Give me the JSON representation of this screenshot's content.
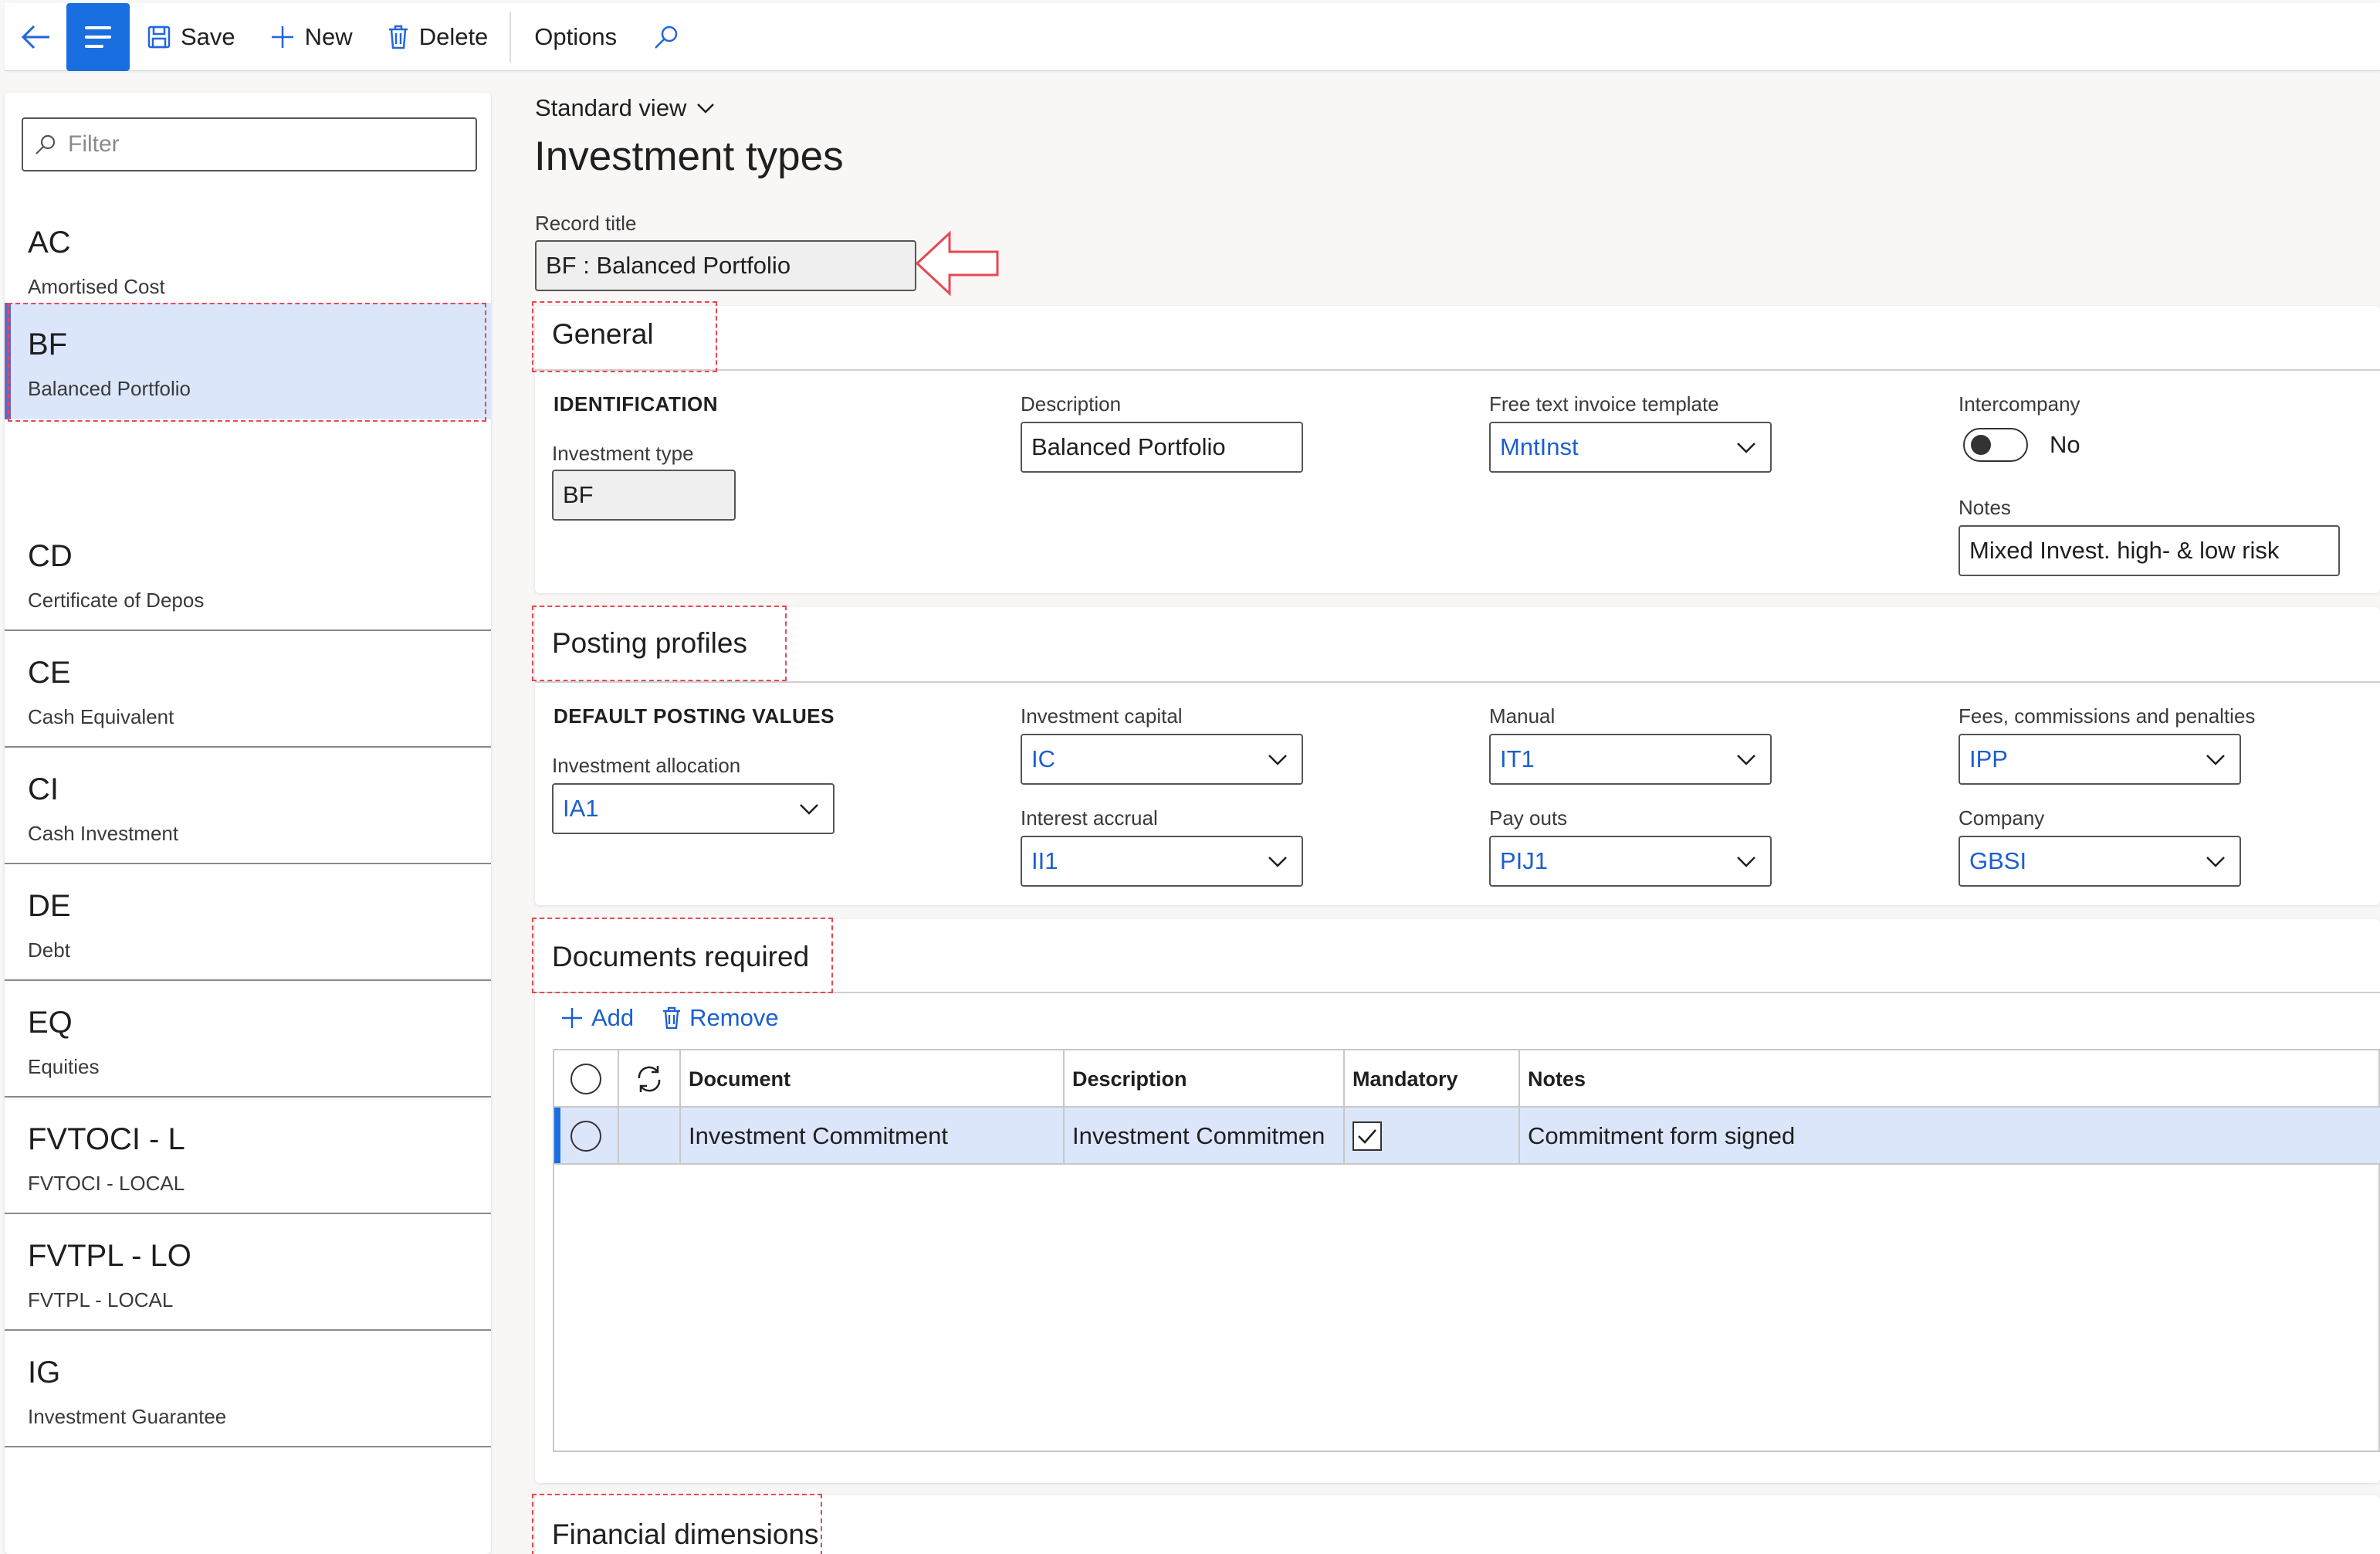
{
  "toolbar": {
    "save_label": "Save",
    "new_label": "New",
    "delete_label": "Delete",
    "options_label": "Options"
  },
  "filter": {
    "placeholder": "Filter"
  },
  "list": {
    "items": [
      {
        "code": "AC",
        "desc": "Amortised Cost"
      },
      {
        "code": "BF",
        "desc": "Balanced Portfolio"
      },
      {
        "code": "CD",
        "desc": "Certificate of Depos"
      },
      {
        "code": "CE",
        "desc": "Cash Equivalent"
      },
      {
        "code": "CI",
        "desc": "Cash Investment"
      },
      {
        "code": "DE",
        "desc": "Debt"
      },
      {
        "code": "EQ",
        "desc": "Equities"
      },
      {
        "code": "FVTOCI - L",
        "desc": "FVTOCI - LOCAL"
      },
      {
        "code": "FVTPL - LO",
        "desc": "FVTPL - LOCAL"
      },
      {
        "code": "IG",
        "desc": "Investment Guarantee"
      }
    ],
    "selected_index": 1
  },
  "page": {
    "view": "Standard view",
    "title": "Investment types",
    "record_title_label": "Record title",
    "record_title_value": "BF : Balanced Portfolio"
  },
  "general": {
    "heading": "General",
    "identification": "IDENTIFICATION",
    "investment_type_label": "Investment type",
    "investment_type_value": "BF",
    "description_label": "Description",
    "description_value": "Balanced Portfolio",
    "free_text_label": "Free text invoice template",
    "free_text_value": "MntInst",
    "intercompany_label": "Intercompany",
    "intercompany_value": "No",
    "notes_label": "Notes",
    "notes_value": "Mixed Invest. high- & low risk"
  },
  "posting": {
    "heading": "Posting profiles",
    "default_values": "DEFAULT POSTING VALUES",
    "investment_allocation_label": "Investment allocation",
    "investment_allocation_value": "IA1",
    "investment_capital_label": "Investment capital",
    "investment_capital_value": "IC",
    "interest_accrual_label": "Interest accrual",
    "interest_accrual_value": "II1",
    "manual_label": "Manual",
    "manual_value": "IT1",
    "payouts_label": "Pay outs",
    "payouts_value": "PIJ1",
    "fees_label": "Fees, commissions and penalties",
    "fees_value": "IPP",
    "company_label": "Company",
    "company_value": "GBSI"
  },
  "documents": {
    "heading": "Documents required",
    "add_label": "Add",
    "remove_label": "Remove",
    "columns": [
      "Document",
      "Description",
      "Mandatory",
      "Notes"
    ],
    "rows": [
      {
        "document": "Investment Commitment",
        "description": "Investment Commitmen",
        "mandatory": true,
        "notes": "Commitment form signed"
      }
    ]
  },
  "financial": {
    "heading": "Financial dimensions"
  },
  "colors": {
    "accent": "#1a6fe0",
    "highlight_box": "#e84852",
    "selected_row": "#dce6fb"
  }
}
